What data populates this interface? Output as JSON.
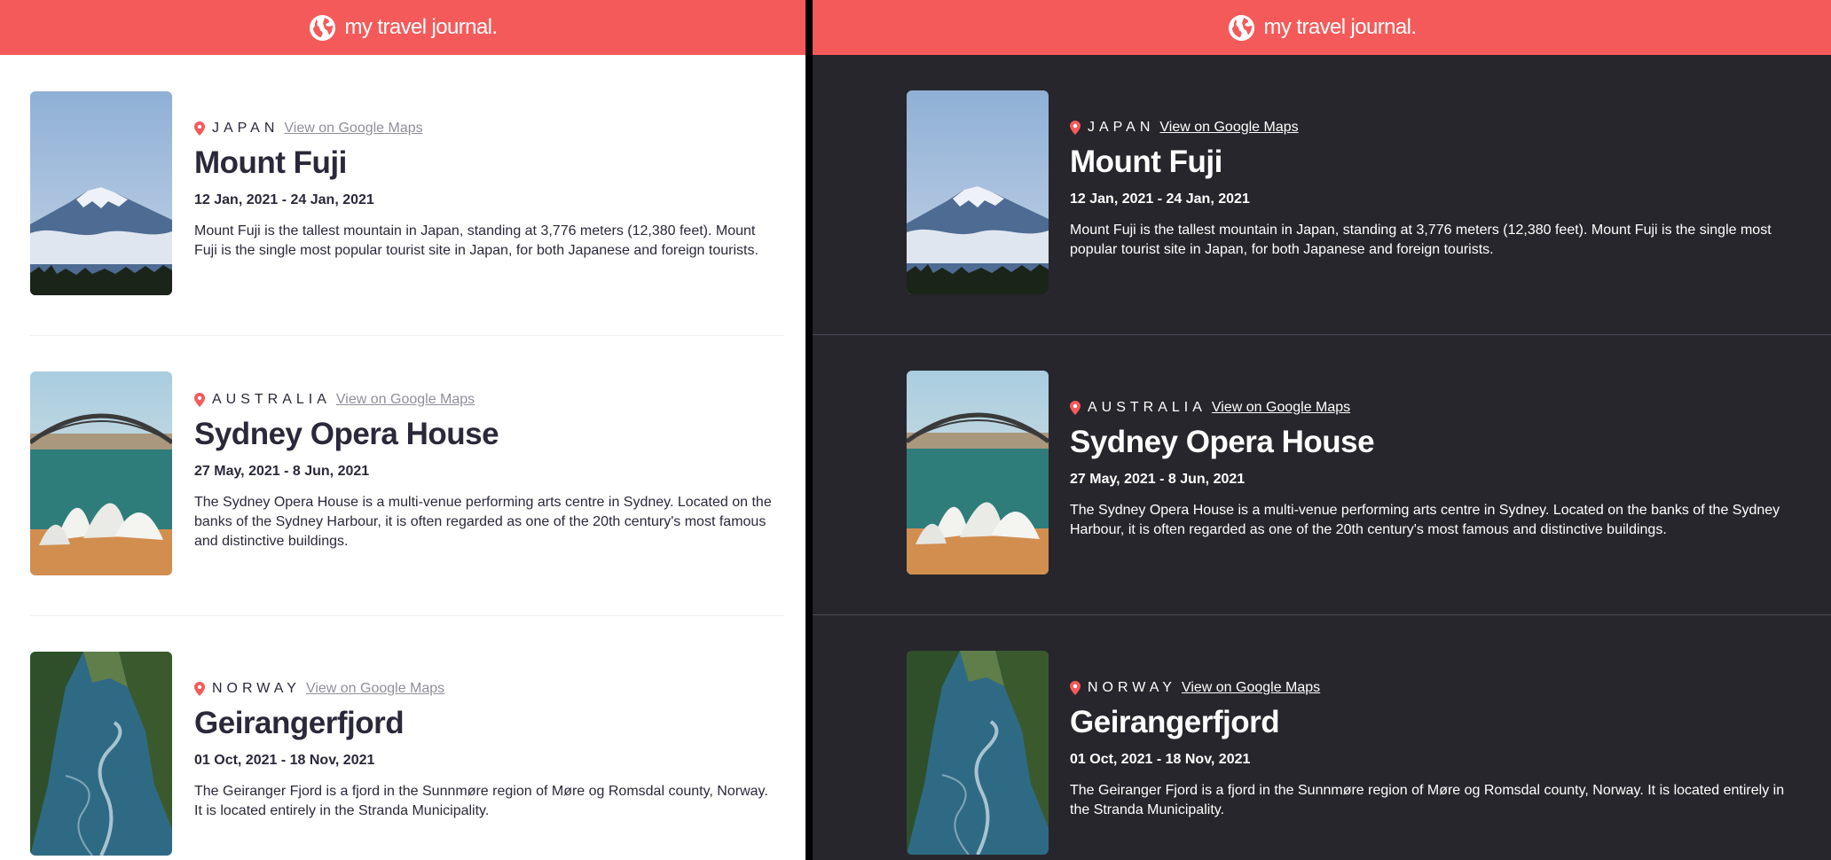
{
  "app": {
    "title": "my travel journal.",
    "icon": "globe-icon",
    "accent": "#f55a5a"
  },
  "themes": {
    "light_bg": "#ffffff",
    "dark_bg": "#27262c"
  },
  "entries": [
    {
      "country": "JAPAN",
      "maps_label": "View on Google Maps",
      "title": "Mount Fuji",
      "dates": "12 Jan, 2021 - 24 Jan, 2021",
      "description": "Mount Fuji is the tallest mountain in Japan, standing at 3,776 meters (12,380 feet). Mount Fuji is the single most popular tourist site in Japan, for both Japanese and foreign tourists.",
      "image": "mount-fuji-photo"
    },
    {
      "country": "AUSTRALIA",
      "maps_label": "View on Google Maps",
      "title": "Sydney Opera House",
      "dates": "27 May, 2021 - 8 Jun, 2021",
      "description": "The Sydney Opera House is a multi-venue performing arts centre in Sydney. Located on the banks of the Sydney Harbour, it is often regarded as one of the 20th century's most famous and distinctive buildings.",
      "image": "sydney-opera-house-photo"
    },
    {
      "country": "NORWAY",
      "maps_label": "View on Google Maps",
      "title": "Geirangerfjord",
      "dates": "01 Oct, 2021 - 18 Nov, 2021",
      "description": "The Geiranger Fjord is a fjord in the Sunnmøre region of Møre og Romsdal county, Norway. It is located entirely in the Stranda Municipality.",
      "image": "geirangerfjord-photo"
    }
  ]
}
